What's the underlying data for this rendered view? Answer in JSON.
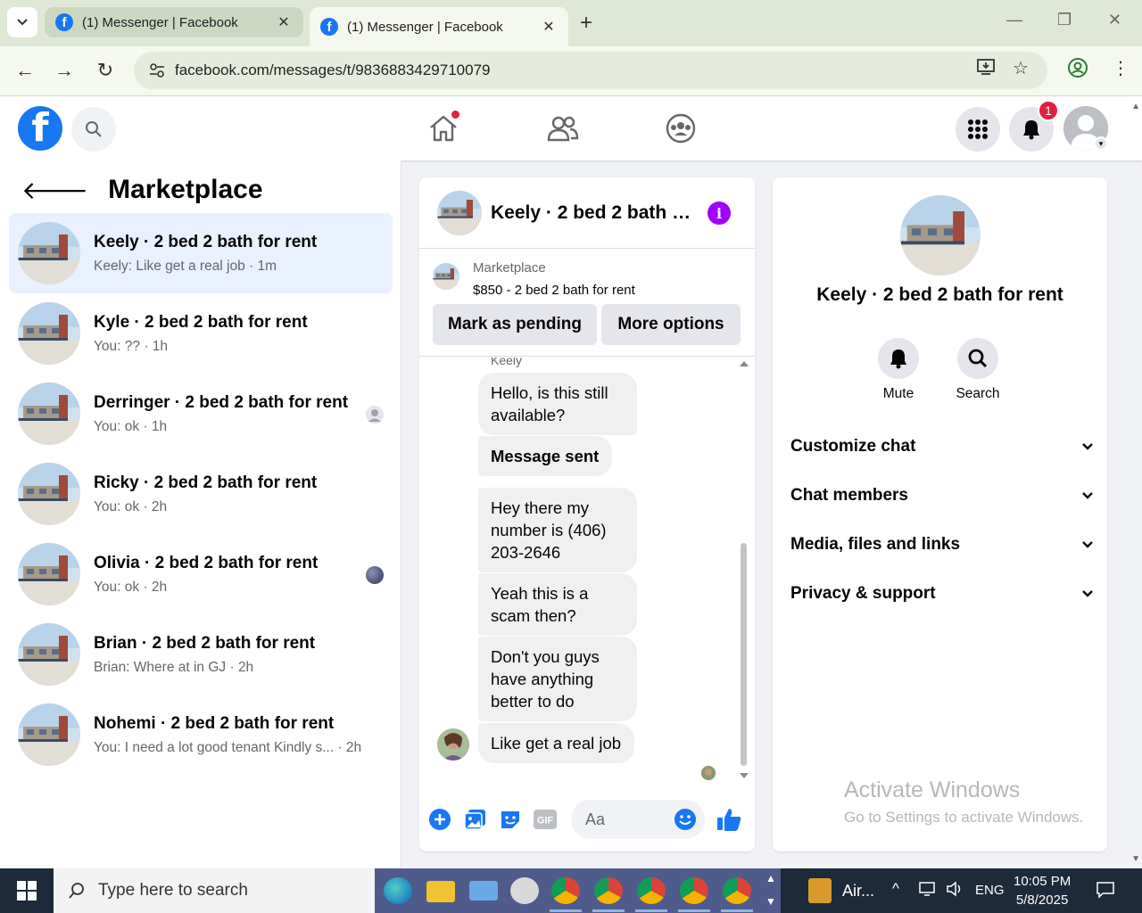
{
  "browser": {
    "tabs": [
      {
        "title": "(1) Messenger | Facebook",
        "active": false
      },
      {
        "title": "(1) Messenger | Facebook",
        "active": true
      }
    ],
    "url": "facebook.com/messages/t/9836883429710079"
  },
  "header": {
    "notification_count": "1"
  },
  "left": {
    "title": "Marketplace",
    "conversations": [
      {
        "name": "Keely · 2 bed 2 bath for rent",
        "preview": "Keely: Like get a real job · 1m",
        "active": true
      },
      {
        "name": "Kyle · 2 bed 2 bath for rent",
        "preview": "You: ?? · 1h",
        "active": false
      },
      {
        "name": "Derringer · 2 bed 2 bath for rent",
        "preview": "You: ok · 1h",
        "active": false
      },
      {
        "name": "Ricky · 2 bed 2 bath for rent",
        "preview": "You: ok · 2h",
        "active": false
      },
      {
        "name": "Olivia · 2 bed 2 bath for rent",
        "preview": "You: ok · 2h",
        "active": false
      },
      {
        "name": "Brian · 2 bed 2 bath for rent",
        "preview": "Brian: Where at in GJ · 2h",
        "active": false
      },
      {
        "name": "Nohemi · 2 bed 2 bath for rent",
        "preview": "You: I need a lot good tenant Kindly s... · 2h",
        "active": false
      }
    ]
  },
  "chat": {
    "title": "Keely · 2 bed 2 bath f...",
    "listing": {
      "category": "Marketplace",
      "price_title": "$850 - 2 bed 2 bath for rent",
      "pending_label": "Mark as pending",
      "more_label": "More options"
    },
    "sender": "Keely",
    "messages": [
      {
        "text": "Hello, is this still available?",
        "bold": false
      },
      {
        "text": "Message sent",
        "bold": true
      },
      {
        "text": "Hey there my number is (406) 203-2646",
        "bold": false
      },
      {
        "text": "Yeah this is a scam then?",
        "bold": false
      },
      {
        "text": "Don't you guys have anything better to do",
        "bold": false
      },
      {
        "text": "Like get a real job",
        "bold": false
      }
    ],
    "composer_placeholder": "Aa",
    "gif_label": "GIF"
  },
  "details": {
    "name": "Keely · 2 bed 2 bath for rent",
    "actions": [
      {
        "label": "Mute"
      },
      {
        "label": "Search"
      }
    ],
    "sections": [
      {
        "label": "Customize chat"
      },
      {
        "label": "Chat members"
      },
      {
        "label": "Media, files and links"
      },
      {
        "label": "Privacy & support"
      }
    ],
    "watermark_title": "Activate Windows",
    "watermark_sub": "Go to Settings to activate Windows."
  },
  "taskbar": {
    "search_placeholder": "Type here to search",
    "tray_app": "Air...",
    "language": "ENG",
    "time": "10:05 PM",
    "date": "5/8/2025"
  },
  "colors": {
    "facebook_blue": "#1877f2",
    "messenger_purple": "#a100ff",
    "active_conversation": "#e8f1fd",
    "notification_red": "#e41e3f"
  }
}
